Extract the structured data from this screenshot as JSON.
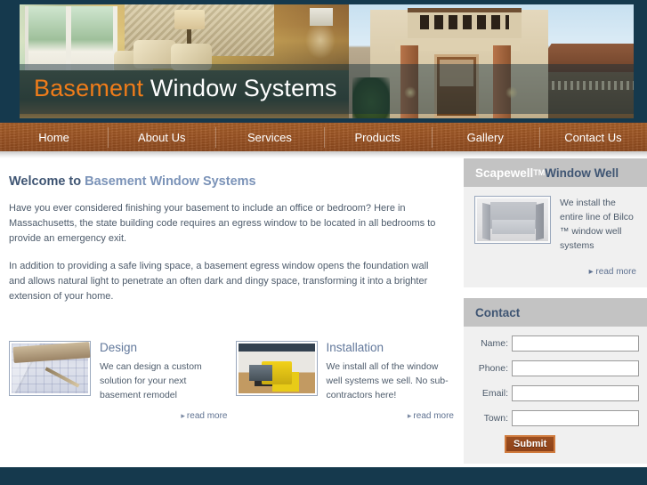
{
  "site": {
    "logo_primary": "Basement",
    "logo_secondary": "Window Systems",
    "brand_orange": "#ef7c1a",
    "brand_navy": "#15394d",
    "brand_rust": "#9d5524",
    "heading_blue": "#3f5573"
  },
  "nav": {
    "items": [
      {
        "label": "Home"
      },
      {
        "label": "About Us"
      },
      {
        "label": "Services"
      },
      {
        "label": "Products"
      },
      {
        "label": "Gallery"
      },
      {
        "label": "Contact Us"
      }
    ]
  },
  "main": {
    "title_lead": "Welcome to ",
    "title_brand": "Basement Window Systems",
    "paragraphs": [
      "Have you ever considered finishing your basement to include an office or bedroom? Here in Massachusetts, the state building code requires an egress window to be located in all bedrooms to provide an emergency exit.",
      "In addition to providing a safe living space, a basement egress window opens the foundation wall and allows natural light to penetrate an often dark and dingy space, transforming it into a brighter extension of your home."
    ],
    "cards": [
      {
        "title": "Design",
        "text": "We can design a custom solution for your next basement remodel",
        "read_more": "read more",
        "thumb_icon": "blueprint-drafting-image"
      },
      {
        "title": "Installation",
        "text": "We install all of the window well systems we sell. No sub-contractors here!",
        "read_more": "read more",
        "thumb_icon": "excavator-jobsite-image"
      }
    ]
  },
  "sidebar": {
    "scapewell": {
      "head_brand": "Scapewell",
      "head_tm": "TM",
      "head_rest": " Window Well",
      "thumb_icon": "window-well-product-image",
      "text": "We install the entire line of Bilco ™ window well systems",
      "read_more": "read more"
    },
    "contact": {
      "head": "Contact",
      "fields": [
        {
          "label": "Name:",
          "value": "",
          "placeholder": ""
        },
        {
          "label": "Phone:",
          "value": "",
          "placeholder": ""
        },
        {
          "label": "Email:",
          "value": "",
          "placeholder": ""
        },
        {
          "label": "Town:",
          "value": "",
          "placeholder": ""
        }
      ],
      "submit_label": "Submit"
    }
  }
}
